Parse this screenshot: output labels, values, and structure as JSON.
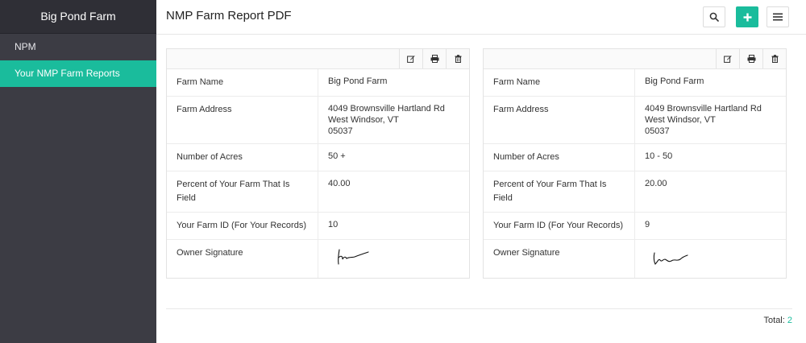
{
  "sidebar": {
    "brand": "Big Pond Farm",
    "items": [
      {
        "label": "NPM"
      },
      {
        "label": "Your NMP Farm Reports"
      }
    ]
  },
  "header": {
    "title": "NMP Farm Report PDF"
  },
  "records": [
    {
      "rows": [
        {
          "label": "Farm Name",
          "value": [
            "Big Pond Farm"
          ]
        },
        {
          "label": "Farm Address",
          "value": [
            "4049 Brownsville Hartland Rd",
            "West Windsor, VT",
            "05037"
          ]
        },
        {
          "label": "Number of Acres",
          "value": [
            "50 +"
          ]
        },
        {
          "label": "Percent of Your Farm That Is Field",
          "value": [
            "40.00"
          ]
        },
        {
          "label": "Your Farm ID (For Your Records)",
          "value": [
            "10"
          ]
        },
        {
          "label": "Owner Signature",
          "value": []
        }
      ]
    },
    {
      "rows": [
        {
          "label": "Farm Name",
          "value": [
            "Big Pond Farm"
          ]
        },
        {
          "label": "Farm Address",
          "value": [
            "4049 Brownsville Hartland Rd",
            "West Windsor, VT",
            "05037"
          ]
        },
        {
          "label": "Number of Acres",
          "value": [
            "10 - 50"
          ]
        },
        {
          "label": "Percent of Your Farm That Is Field",
          "value": [
            "20.00"
          ]
        },
        {
          "label": "Your Farm ID (For Your Records)",
          "value": [
            "9"
          ]
        },
        {
          "label": "Owner Signature",
          "value": []
        }
      ]
    }
  ],
  "footer": {
    "total_label": "Total:",
    "total_value": "2"
  },
  "icons": {
    "search": "search-icon",
    "add": "plus-icon",
    "menu": "hamburger-menu-icon",
    "edit": "edit-icon",
    "print": "print-icon",
    "delete": "trash-icon"
  },
  "colors": {
    "accent": "#1abc9c",
    "sidebar": "#3c3c44",
    "sidebar_brand": "#2f2f36"
  }
}
